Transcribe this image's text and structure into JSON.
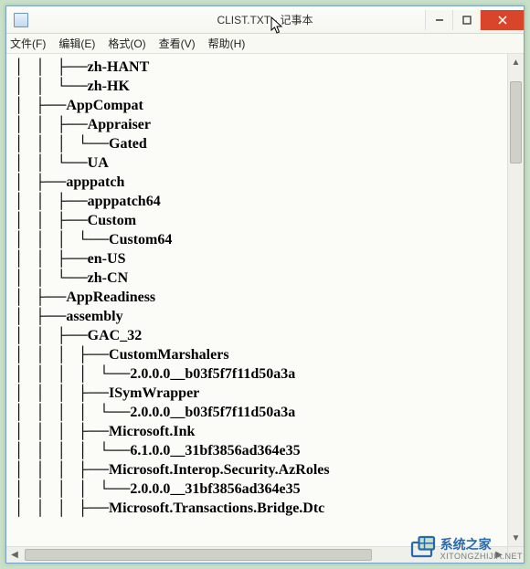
{
  "window": {
    "title": "CLIST.TXT - 记事本"
  },
  "menu": {
    "file": "文件(F)",
    "edit": "编辑(E)",
    "format": "格式(O)",
    "view": "查看(V)",
    "help": "帮助(H)"
  },
  "tree_lines": [
    "│   │   ├──zh-HANT",
    "│   │   └──zh-HK",
    "│   ├──AppCompat",
    "│   │   ├──Appraiser",
    "│   │   │   └──Gated",
    "│   │   └──UA",
    "│   ├──apppatch",
    "│   │   ├──apppatch64",
    "│   │   ├──Custom",
    "│   │   │   └──Custom64",
    "│   │   ├──en-US",
    "│   │   └──zh-CN",
    "│   ├──AppReadiness",
    "│   ├──assembly",
    "│   │   ├──GAC_32",
    "│   │   │   ├──CustomMarshalers",
    "│   │   │   │   └──2.0.0.0__b03f5f7f11d50a3a",
    "│   │   │   ├──ISymWrapper",
    "│   │   │   │   └──2.0.0.0__b03f5f7f11d50a3a",
    "│   │   │   ├──Microsoft.Ink",
    "│   │   │   │   └──6.1.0.0__31bf3856ad364e35",
    "│   │   │   ├──Microsoft.Interop.Security.AzRoles",
    "│   │   │   │   └──2.0.0.0__31bf3856ad364e35",
    "│   │   │   ├──Microsoft.Transactions.Bridge.Dtc"
  ],
  "watermark": {
    "brand": "系统之家",
    "url": "XITONGZHIJIA.NET"
  }
}
